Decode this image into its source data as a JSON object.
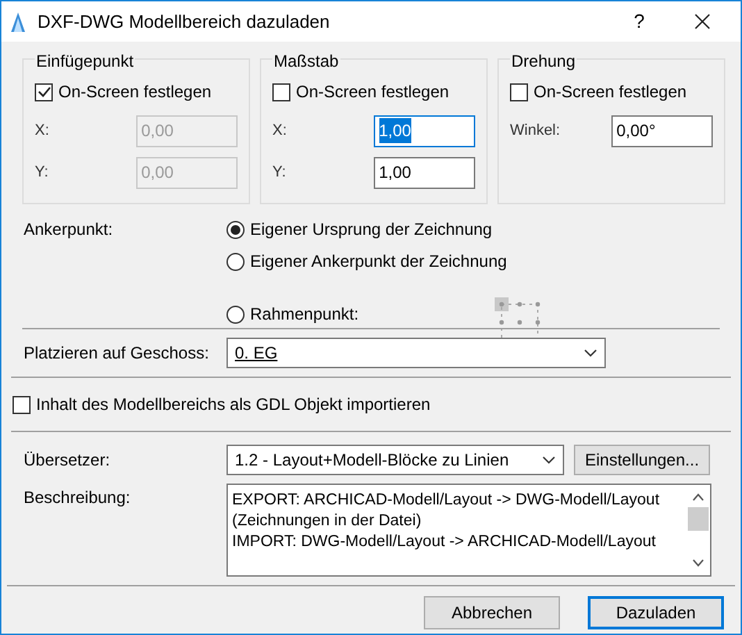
{
  "window": {
    "title": "DXF-DWG Modellbereich dazuladen",
    "help": "?"
  },
  "groups": [
    {
      "title": "Einfügepunkt",
      "checkbox": {
        "label": "On-Screen festlegen",
        "checked": true
      },
      "fields": [
        {
          "label": "X:",
          "value": "0,00",
          "disabled": true,
          "text_selected": false
        },
        {
          "label": "Y:",
          "value": "0,00",
          "disabled": true,
          "text_selected": false
        }
      ]
    },
    {
      "title": "Maßstab",
      "checkbox": {
        "label": "On-Screen festlegen",
        "checked": false
      },
      "fields": [
        {
          "label": "X:",
          "value": "1,00",
          "disabled": false,
          "text_selected": true
        },
        {
          "label": "Y:",
          "value": "1,00",
          "disabled": false,
          "text_selected": false
        }
      ]
    },
    {
      "title": "Drehung",
      "checkbox": {
        "label": "On-Screen festlegen",
        "checked": false
      },
      "fields": [
        {
          "label": "Winkel:",
          "value": "0,00°",
          "disabled": false,
          "text_selected": false
        }
      ]
    }
  ],
  "anchor": {
    "label": "Ankerpunkt:",
    "options": [
      {
        "label": "Eigener Ursprung der Zeichnung",
        "selected": true
      },
      {
        "label": "Eigener Ankerpunkt der Zeichnung",
        "selected": false
      },
      {
        "label": "Rahmenpunkt:",
        "selected": false
      }
    ]
  },
  "storey": {
    "label": "Platzieren auf Geschoss:",
    "value": "0. EG"
  },
  "gdl_import": {
    "label": "Inhalt des Modellbereichs als GDL Objekt importieren",
    "checked": false
  },
  "translator": {
    "label": "Übersetzer:",
    "value": "1.2 - Layout+Modell-Blöcke zu Linien",
    "button": "Einstellungen..."
  },
  "description": {
    "label": "Beschreibung:",
    "lines": [
      "EXPORT: ARCHICAD-Modell/Layout -> DWG-Modell/Layout",
      "(Zeichnungen in der Datei)",
      "IMPORT: DWG-Modell/Layout -> ARCHICAD-Modell/Layout"
    ]
  },
  "buttons": [
    {
      "label": "Abbrechen",
      "default": false
    },
    {
      "label": "Dazuladen",
      "default": true
    }
  ]
}
